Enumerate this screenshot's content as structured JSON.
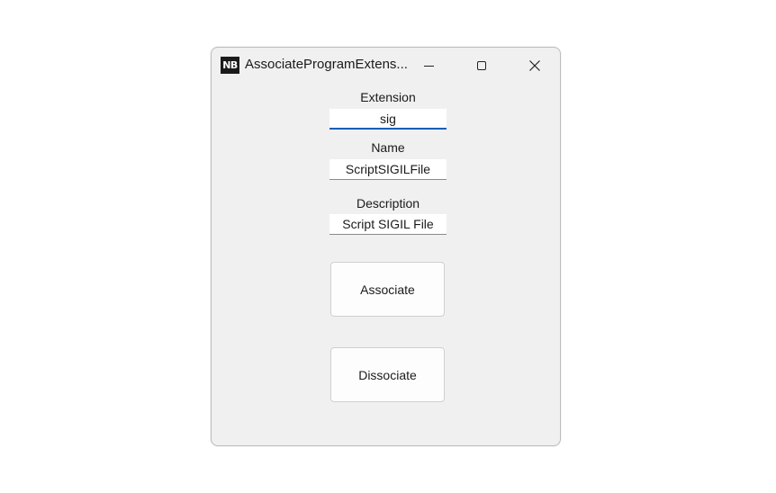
{
  "window": {
    "title": "AssociateProgramExtens...",
    "app_icon_text": "NB",
    "controls": {
      "minimize": "minimize-icon",
      "maximize": "maximize-icon",
      "close": "close-icon"
    }
  },
  "form": {
    "extension": {
      "label": "Extension",
      "value": "sig"
    },
    "name": {
      "label": "Name",
      "value": "ScriptSIGILFile"
    },
    "description": {
      "label": "Description",
      "value": "Script SIGIL File"
    }
  },
  "buttons": {
    "associate": "Associate",
    "dissociate": "Dissociate"
  },
  "colors": {
    "window_bg": "#f0f0f0",
    "focus_accent": "#005fb8"
  }
}
